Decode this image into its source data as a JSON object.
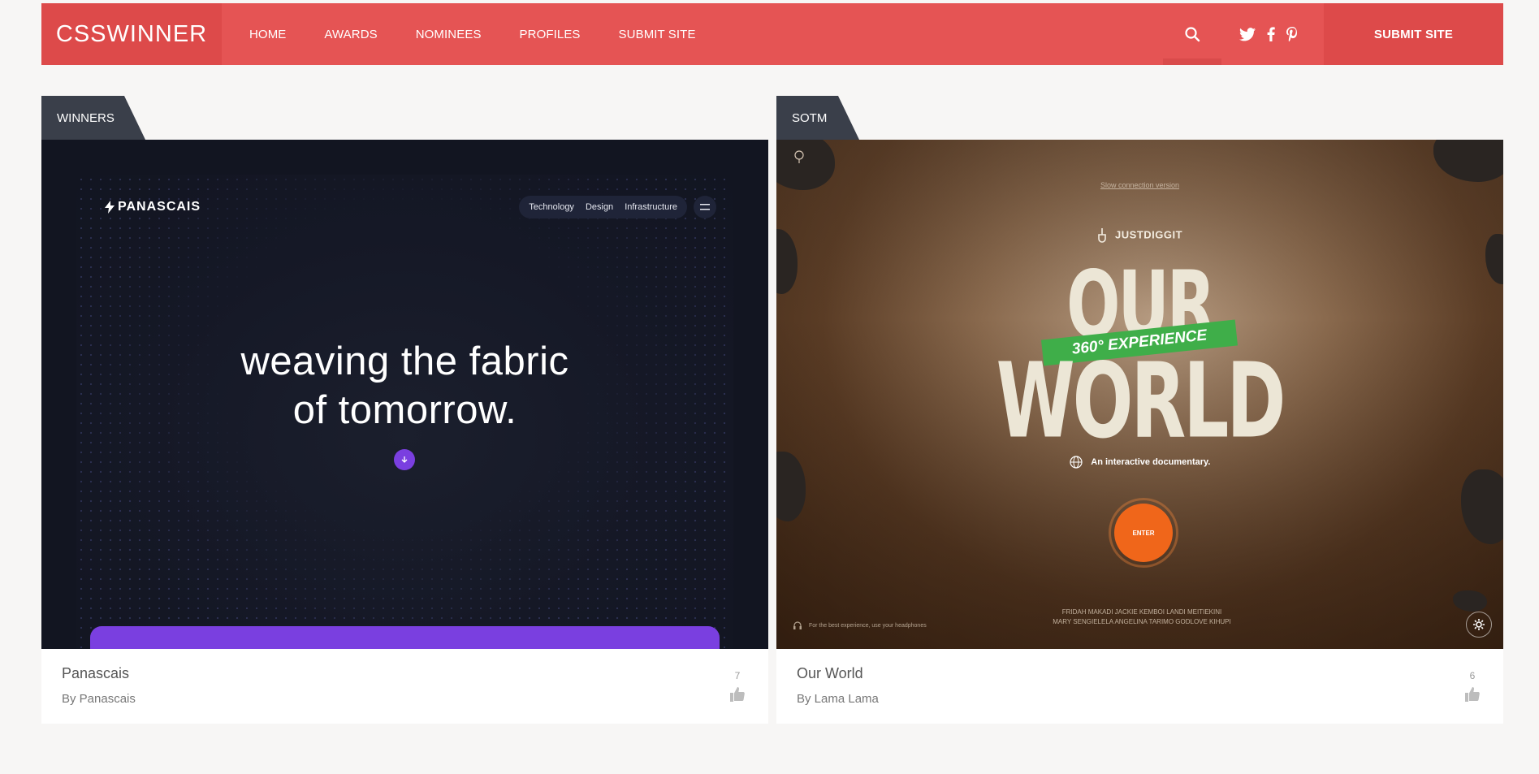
{
  "header": {
    "logo": "CSSWINNER",
    "nav": [
      "HOME",
      "AWARDS",
      "NOMINEES",
      "PROFILES",
      "SUBMIT SITE"
    ],
    "submit_label": "SUBMIT SITE",
    "icons": [
      "search-icon",
      "twitter-icon",
      "facebook-icon",
      "pinterest-icon"
    ]
  },
  "cards": [
    {
      "tag": "WINNERS",
      "title": "Panascais",
      "author": "By Panascais",
      "likes": "7",
      "shot": {
        "brand": "PANASCAIS",
        "menu": [
          "Technology",
          "Design",
          "Infrastructure"
        ],
        "headline_line1": "weaving the fabric",
        "headline_line2": "of tomorrow."
      }
    },
    {
      "tag": "SOTM",
      "title": "Our World",
      "author": "By Lama Lama",
      "likes": "6",
      "shot": {
        "slow": "Slow connection version",
        "brand": "JUSTDIGGIT",
        "title_top": "OUR",
        "badge": "360° EXPERIENCE",
        "title_bottom": "WORLD",
        "subtitle": "An interactive documentary.",
        "enter": "ENTER",
        "headphones": "For the best experience, use your headphones",
        "credits_line1": "FRIDAH MAKADI   JACKIE KEMBOI   LANDI MEITIEKINI",
        "credits_line2": "MARY SENGIELELA   ANGELINA TARIMO   GODLOVE KIHUPI"
      }
    }
  ],
  "colors": {
    "header": "#e55454",
    "logo_bg": "#dd4a4a",
    "tag_bg": "#3a3f4a",
    "accent_purple": "#7a3fe0",
    "accent_orange": "#f0661a",
    "accent_green": "#3fae49"
  }
}
